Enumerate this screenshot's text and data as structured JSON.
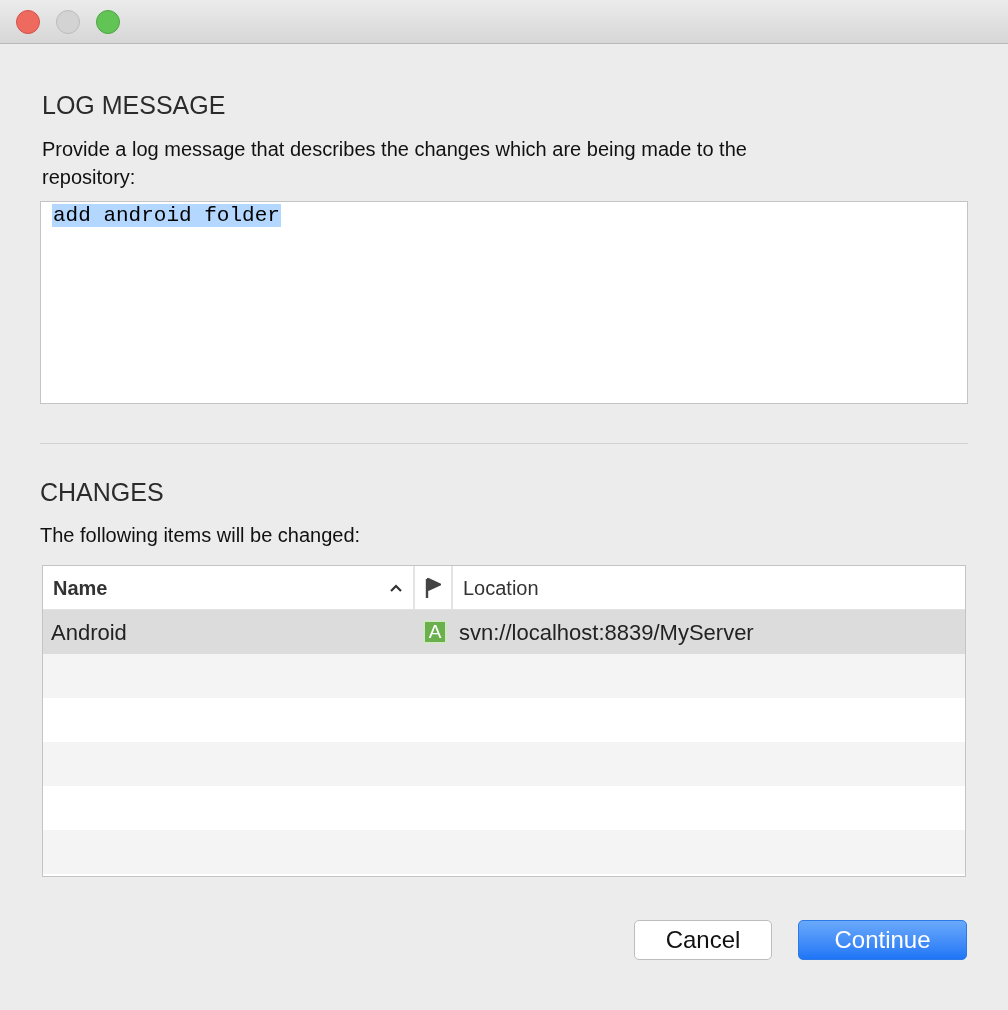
{
  "window": {
    "buttons": [
      {
        "kind": "close"
      },
      {
        "kind": "minimize",
        "disabled": true
      },
      {
        "kind": "zoom"
      }
    ]
  },
  "log_message": {
    "heading": "LOG MESSAGE",
    "description": "Provide a log message that describes the changes which are being made to the repository:",
    "message": {
      "value": "add android folder",
      "selected": true
    }
  },
  "changes": {
    "heading": "CHANGES",
    "description": "The following items will be changed:",
    "table": {
      "columns": [
        {
          "kind": "text",
          "label": "Name",
          "sorted": true
        },
        {
          "kind": "flag"
        },
        {
          "kind": "text",
          "label": "Location"
        }
      ],
      "rows": [
        {
          "name": "Android",
          "status": "A",
          "color": "#6ab04c",
          "location": "svn://localhost:8839/MyServer",
          "selected": true
        }
      ]
    }
  },
  "buttons": [
    {
      "label": "Cancel",
      "default": false
    },
    {
      "label": "Continue",
      "default": true
    }
  ]
}
